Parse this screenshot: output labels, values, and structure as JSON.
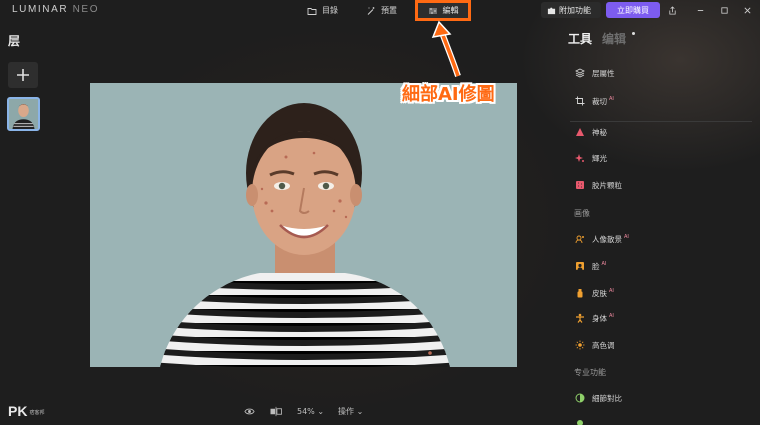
{
  "app": {
    "logo_main": "LUMINAR",
    "logo_sub": "NEO"
  },
  "nav": {
    "catalog": "目錄",
    "presets": "預置",
    "edit": "編輯"
  },
  "header": {
    "addons": "附加功能",
    "buy": "立即購買"
  },
  "left": {
    "layers_title": "层"
  },
  "annotation": {
    "text": "細部AI修圖"
  },
  "bottom": {
    "zoom": "54%",
    "actions": "操作"
  },
  "right": {
    "tab_tools": "工具",
    "tab_edit": "编辑",
    "items_top": [
      {
        "label": "层屬性",
        "icon": "layers-icon"
      },
      {
        "label": "裁切",
        "icon": "crop-icon",
        "ai": "AI"
      }
    ],
    "items_creative": [
      {
        "label": "神秘",
        "icon": "mystic-icon"
      },
      {
        "label": "輝光",
        "icon": "glow-icon"
      },
      {
        "label": "胶片颗粒",
        "icon": "film-grain-icon"
      }
    ],
    "section_portrait": "画像",
    "items_portrait": [
      {
        "label": "人像散景",
        "icon": "portrait-bokeh-icon",
        "ai": "AI"
      },
      {
        "label": "脸",
        "icon": "face-icon",
        "ai": "AI"
      },
      {
        "label": "皮肤",
        "icon": "skin-icon",
        "ai": "AI"
      },
      {
        "label": "身体",
        "icon": "body-icon",
        "ai": "AI"
      },
      {
        "label": "高色调",
        "icon": "high-key-icon"
      }
    ],
    "section_pro": "专业功能",
    "items_pro": [
      {
        "label": "細節對比",
        "icon": "contrast-icon"
      }
    ]
  },
  "watermark": {
    "brand": "PK",
    "sub": "痞客邦"
  },
  "colors": {
    "accent_orange": "#ff6a13",
    "buy_purple": "#7d5cf0",
    "selection_blue": "#8ab4e8"
  }
}
